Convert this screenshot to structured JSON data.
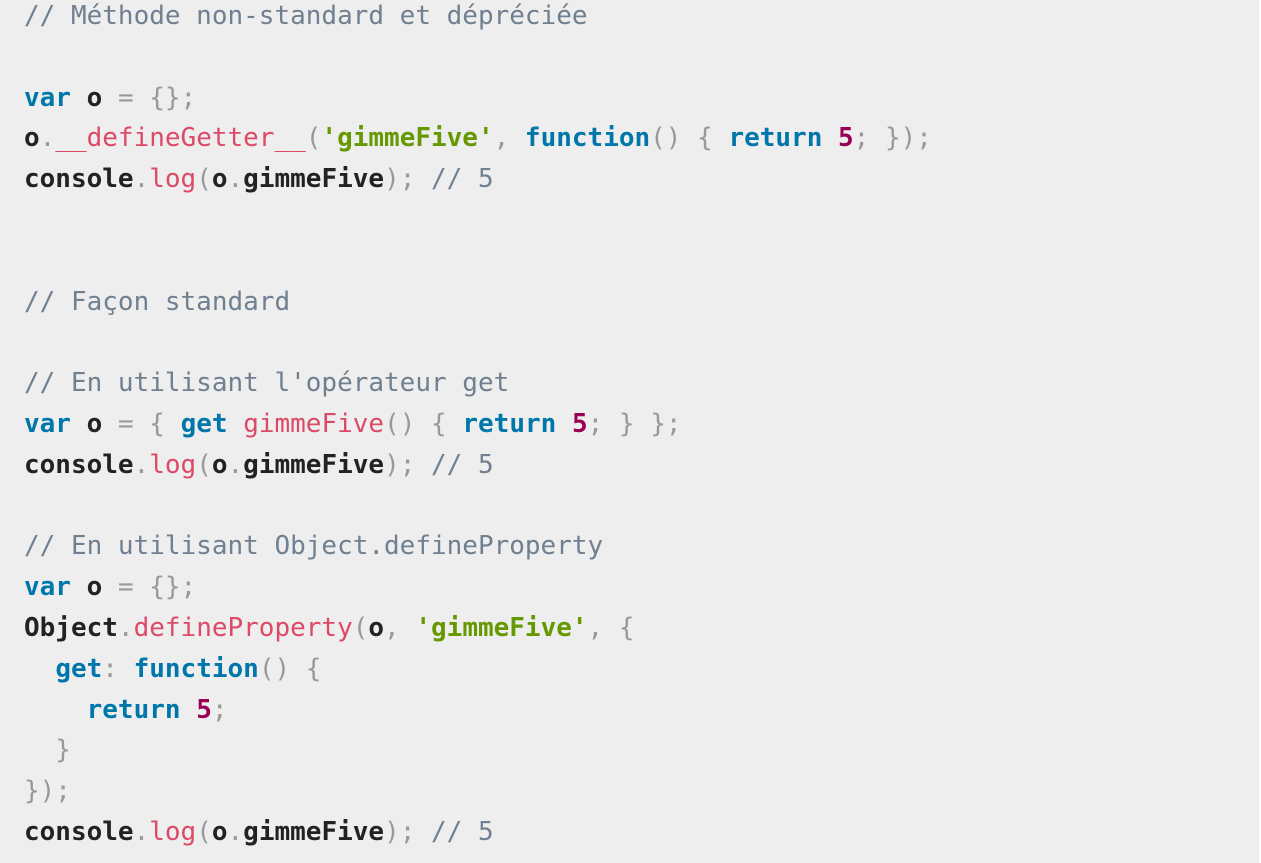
{
  "code_block": {
    "lines": [
      [
        {
          "t": "// Méthode non-standard et dépréciée",
          "k": "comment"
        }
      ],
      [],
      [
        {
          "t": "var",
          "k": "kw"
        },
        {
          "t": " o ",
          "k": "ident"
        },
        {
          "t": "=",
          "k": "punct"
        },
        {
          "t": " ",
          "k": "ident"
        },
        {
          "t": "{};",
          "k": "punct"
        }
      ],
      [
        {
          "t": "o",
          "k": "ident"
        },
        {
          "t": ".",
          "k": "punct"
        },
        {
          "t": "__defineGetter__",
          "k": "fn"
        },
        {
          "t": "(",
          "k": "punct"
        },
        {
          "t": "'gimmeFive'",
          "k": "str"
        },
        {
          "t": ", ",
          "k": "punct"
        },
        {
          "t": "function",
          "k": "kw"
        },
        {
          "t": "() { ",
          "k": "punct"
        },
        {
          "t": "return",
          "k": "kw"
        },
        {
          "t": " ",
          "k": "ident"
        },
        {
          "t": "5",
          "k": "num"
        },
        {
          "t": "; });",
          "k": "punct"
        }
      ],
      [
        {
          "t": "console",
          "k": "ident"
        },
        {
          "t": ".",
          "k": "punct"
        },
        {
          "t": "log",
          "k": "fn"
        },
        {
          "t": "(",
          "k": "punct"
        },
        {
          "t": "o",
          "k": "ident"
        },
        {
          "t": ".",
          "k": "punct"
        },
        {
          "t": "gimmeFive",
          "k": "ident"
        },
        {
          "t": "); ",
          "k": "punct"
        },
        {
          "t": "// 5",
          "k": "comment"
        }
      ],
      [],
      [],
      [
        {
          "t": "// Façon standard",
          "k": "comment"
        }
      ],
      [],
      [
        {
          "t": "// En utilisant l'opérateur get",
          "k": "comment"
        }
      ],
      [
        {
          "t": "var",
          "k": "kw"
        },
        {
          "t": " o ",
          "k": "ident"
        },
        {
          "t": "=",
          "k": "punct"
        },
        {
          "t": " { ",
          "k": "punct"
        },
        {
          "t": "get",
          "k": "kw"
        },
        {
          "t": " ",
          "k": "ident"
        },
        {
          "t": "gimmeFive",
          "k": "fn"
        },
        {
          "t": "() { ",
          "k": "punct"
        },
        {
          "t": "return",
          "k": "kw"
        },
        {
          "t": " ",
          "k": "ident"
        },
        {
          "t": "5",
          "k": "num"
        },
        {
          "t": "; } };",
          "k": "punct"
        }
      ],
      [
        {
          "t": "console",
          "k": "ident"
        },
        {
          "t": ".",
          "k": "punct"
        },
        {
          "t": "log",
          "k": "fn"
        },
        {
          "t": "(",
          "k": "punct"
        },
        {
          "t": "o",
          "k": "ident"
        },
        {
          "t": ".",
          "k": "punct"
        },
        {
          "t": "gimmeFive",
          "k": "ident"
        },
        {
          "t": "); ",
          "k": "punct"
        },
        {
          "t": "// 5",
          "k": "comment"
        }
      ],
      [],
      [
        {
          "t": "// En utilisant Object.defineProperty",
          "k": "comment"
        }
      ],
      [
        {
          "t": "var",
          "k": "kw"
        },
        {
          "t": " o ",
          "k": "ident"
        },
        {
          "t": "=",
          "k": "punct"
        },
        {
          "t": " ",
          "k": "ident"
        },
        {
          "t": "{};",
          "k": "punct"
        }
      ],
      [
        {
          "t": "Object",
          "k": "ident"
        },
        {
          "t": ".",
          "k": "punct"
        },
        {
          "t": "defineProperty",
          "k": "fn"
        },
        {
          "t": "(",
          "k": "punct"
        },
        {
          "t": "o",
          "k": "ident"
        },
        {
          "t": ", ",
          "k": "punct"
        },
        {
          "t": "'gimmeFive'",
          "k": "str"
        },
        {
          "t": ", {",
          "k": "punct"
        }
      ],
      [
        {
          "t": "  ",
          "k": "ident"
        },
        {
          "t": "get",
          "k": "kw"
        },
        {
          "t": ": ",
          "k": "punct"
        },
        {
          "t": "function",
          "k": "kw"
        },
        {
          "t": "() {",
          "k": "punct"
        }
      ],
      [
        {
          "t": "    ",
          "k": "ident"
        },
        {
          "t": "return",
          "k": "kw"
        },
        {
          "t": " ",
          "k": "ident"
        },
        {
          "t": "5",
          "k": "num"
        },
        {
          "t": ";",
          "k": "punct"
        }
      ],
      [
        {
          "t": "  }",
          "k": "punct"
        }
      ],
      [
        {
          "t": "});",
          "k": "punct"
        }
      ],
      [
        {
          "t": "console",
          "k": "ident"
        },
        {
          "t": ".",
          "k": "punct"
        },
        {
          "t": "log",
          "k": "fn"
        },
        {
          "t": "(",
          "k": "punct"
        },
        {
          "t": "o",
          "k": "ident"
        },
        {
          "t": ".",
          "k": "punct"
        },
        {
          "t": "gimmeFive",
          "k": "ident"
        },
        {
          "t": "); ",
          "k": "punct"
        },
        {
          "t": "// 5",
          "k": "comment"
        }
      ]
    ]
  }
}
